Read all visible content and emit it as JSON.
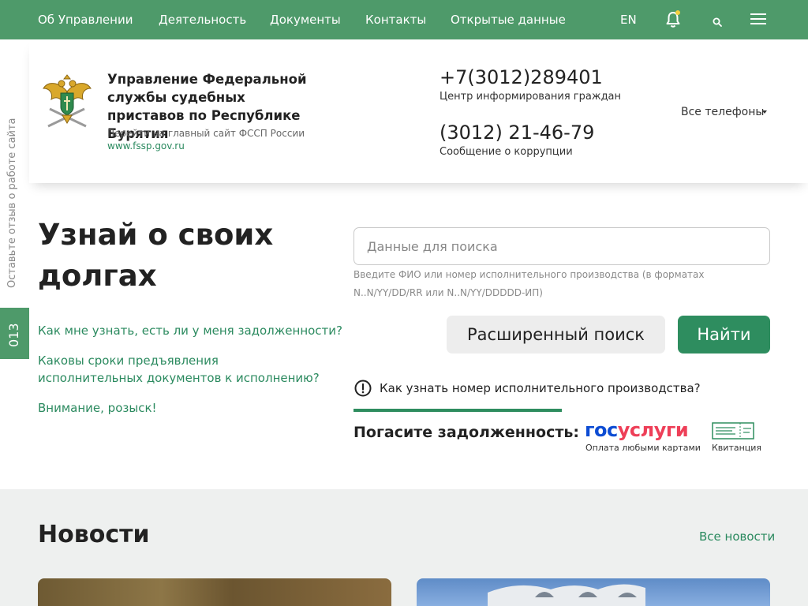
{
  "nav": {
    "links": [
      "Об Управлении",
      "Деятельность",
      "Документы",
      "Контакты",
      "Открытые данные"
    ],
    "lang": "EN"
  },
  "header": {
    "org_title": "Управление Федеральной службы судебных приставов по Республике Бурятия",
    "main_site_text": "Перейти на главный сайт ФССП России",
    "main_site_link": "www.fssp.gov.ru",
    "phone1": "+7(3012)289401",
    "phone1_label": "Центр информирования граждан",
    "phone2": "(3012) 21-46-79",
    "phone2_label": "Сообщение о коррупции",
    "all_phones": "Все телефоны"
  },
  "side": {
    "feedback": "Оставьте отзыв о работе сайта",
    "badge": "013"
  },
  "debt": {
    "title": "Узнай о своих долгах",
    "faq": [
      "Как мне узнать, есть ли у меня задолженности?",
      "Каковы сроки предъявления исполнительных документов к исполнению?",
      "Внимание, розыск!"
    ],
    "search_placeholder": "Данные для поиска",
    "search_hint": "Введите ФИО или номер исполнительного производства (в форматах N..N/YY/DD/RR или N..N/YY/DDDDD-ИП)",
    "advanced_button": "Расширенный поиск",
    "find_button": "Найти",
    "info_link": "Как узнать номер исполнительного производства?",
    "pay_title": "Погасите задолженность:",
    "gosuslugi_a": "гос",
    "gosuslugi_b": "услуги",
    "gosuslugi_label": "Оплата любыми картами",
    "receipt_label": "Квитанция"
  },
  "news": {
    "title": "Новости",
    "all_link": "Все новости"
  },
  "colors": {
    "brand_green": "#4e9a6a",
    "button_green": "#2e8d5f",
    "link_green": "#2b8a5f",
    "gosuslugi_blue": "#0d4cd3",
    "gosuslugi_red": "#ee3f58"
  }
}
